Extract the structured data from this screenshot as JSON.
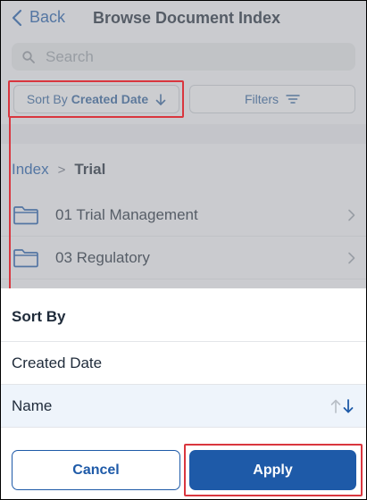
{
  "header": {
    "back_label": "Back",
    "title": "Browse Document Index"
  },
  "search": {
    "placeholder": "Search"
  },
  "toolbar": {
    "sort_prefix": "Sort By",
    "sort_value": "Created Date",
    "filters_label": "Filters"
  },
  "breadcrumb": {
    "root": "Index",
    "separator": ">",
    "current": "Trial"
  },
  "folders": [
    {
      "name": "01 Trial Management"
    },
    {
      "name": "03 Regulatory"
    }
  ],
  "sort_sheet": {
    "title": "Sort By",
    "options": [
      {
        "label": "Created Date",
        "selected": false
      },
      {
        "label": "Name",
        "selected": true
      }
    ],
    "cancel_label": "Cancel",
    "apply_label": "Apply"
  },
  "colors": {
    "accent": "#1e5aa8",
    "annotation": "#d9363e",
    "selected_row": "#eef4fb"
  },
  "icons": [
    "chevron-left-icon",
    "search-icon",
    "arrow-down-icon",
    "filter-icon",
    "folder-icon",
    "chevron-right-icon",
    "arrow-up-icon"
  ]
}
